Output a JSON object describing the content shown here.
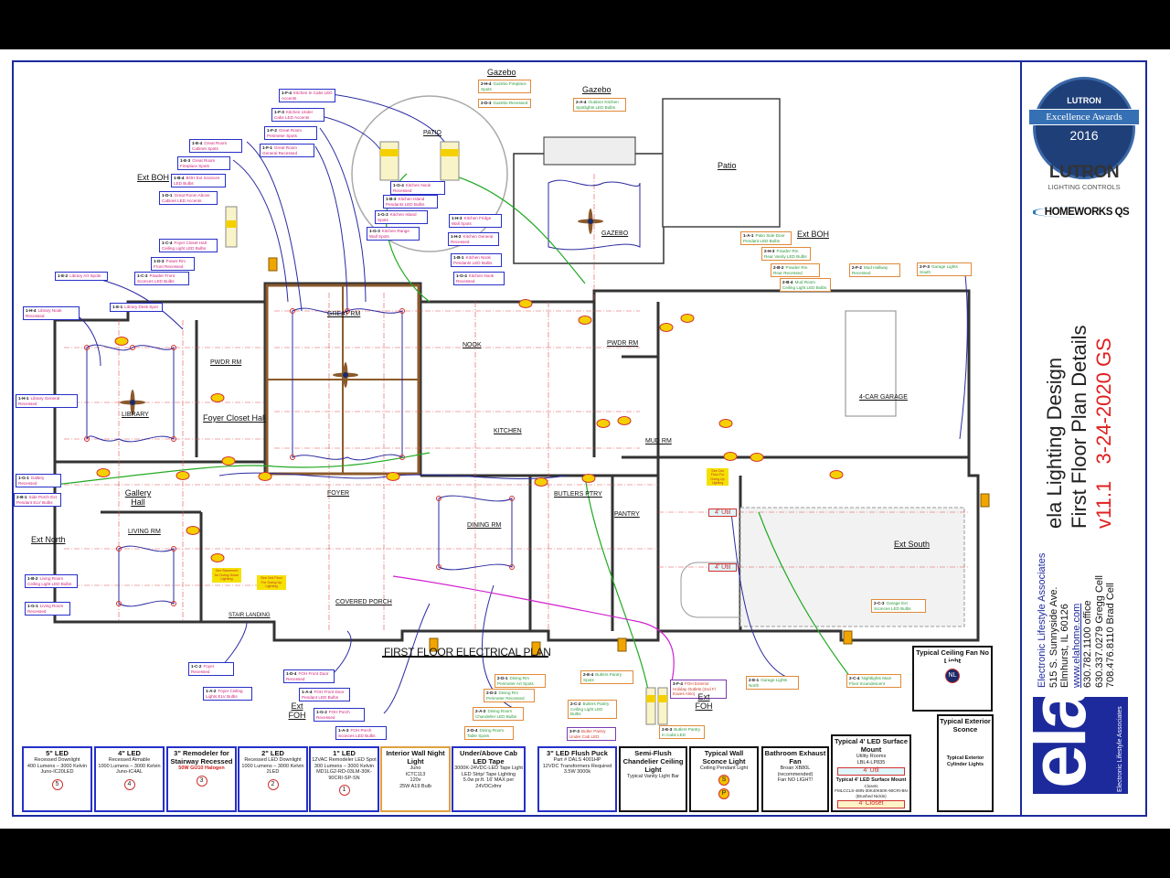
{
  "logos": {
    "award": {
      "brand": "LUTRON",
      "title": "Excellence Awards",
      "year": "2016"
    },
    "lutron": {
      "name": "LUTRON",
      "sub": "LIGHTING CONTROLS"
    },
    "homeworks": "HOMEWORKS QS",
    "ela": {
      "mark": "ela",
      "sub": "Electronic Lifestyle Associates"
    }
  },
  "title_block": {
    "line1": "ela Lighting Design",
    "line2": "First Floor Plan Details",
    "version": "v11.1",
    "date": "3-24-2020 GS"
  },
  "company": {
    "name": "Electronic Lifestyle Associates",
    "address": "515 S. Sunnyside Ave.",
    "city": "Elmhurst, IL 60126",
    "web": "www.elahome.com",
    "office": "630.782.1100 office",
    "cell1": "630.337.0279 Gregg Cell",
    "cell2": "708.476.8110 Brad Cell"
  },
  "plan_title": "FIRST FLOOR ELECTRICAL PLAN",
  "rooms": [
    "Gazebo",
    "Gazebo",
    "PATIO",
    "Patio",
    "GAZEBO",
    "Ext BOH",
    "Ext BOH",
    "GREAT RM",
    "NOOK",
    "KITCHEN",
    "PWDR RM",
    "MUD RM",
    "4-CAR GARAGE",
    "LIBRARY",
    "PWDR RM",
    "Foyer Closet Hall",
    "Gallery Hall",
    "FOYER",
    "BUTLERS PTRY",
    "PANTRY",
    "DINING RM",
    "LIVING RM",
    "Ext North",
    "Ext South",
    "COVERED PORCH",
    "STAIR LANDING",
    "Ext FOH",
    "Ext FOH"
  ],
  "callouts": [
    {
      "code": "1-F-4",
      "text": "Kitchen In Cabs LED Accents",
      "style": "blue"
    },
    {
      "code": "1-F-3",
      "text": "Kitchen Under Cabs LED Accents",
      "style": "blue"
    },
    {
      "code": "1-F-2",
      "text": "Great Room Perimeter Spots",
      "style": "blue"
    },
    {
      "code": "1-F-1",
      "text": "Great Room General Recessed",
      "style": "blue"
    },
    {
      "code": "1-E-4",
      "text": "Great Room Cabinet Spots",
      "style": "blue"
    },
    {
      "code": "1-E-3",
      "text": "Great Room Fireplace Spots",
      "style": "blue"
    },
    {
      "code": "1-B-4",
      "text": "BOH Ext Sconces LED Bulbs",
      "style": "blue"
    },
    {
      "code": "1-D-1",
      "text": "Great Room Above Cabinet LED Accents",
      "style": "blue"
    },
    {
      "code": "1-C-4",
      "text": "Foyer Closet Hall Ceiling Light LED Bulbs",
      "style": "blue"
    },
    {
      "code": "1-D-3",
      "text": "Power Rm Front Recessed",
      "style": "blue"
    },
    {
      "code": "1-C-3",
      "text": "Powder Front Sconces LED Bulbs",
      "style": "blue"
    },
    {
      "code": "1-E-2",
      "text": "Library Art Spots",
      "style": "blue"
    },
    {
      "code": "1-E-1",
      "text": "Library Desk Spot",
      "style": "blue"
    },
    {
      "code": "1-H-4",
      "text": "Library Nook Recessed",
      "style": "blue"
    },
    {
      "code": "1-H-1",
      "text": "Library General Recessed",
      "style": "blue"
    },
    {
      "code": "1-G-1",
      "text": "Gallery Recessed",
      "style": "blue"
    },
    {
      "code": "2-B-1",
      "text": "Side Porch Ext Pendant ELV Bulbs",
      "style": "blue"
    },
    {
      "code": "1-B-2",
      "text": "Living Room Ceiling Light LED Bulbs",
      "style": "blue"
    },
    {
      "code": "1-G-1",
      "text": "Living Room Recessed",
      "style": "blue"
    },
    {
      "code": "1-G-4",
      "text": "Kitchen Nook Recessed",
      "style": "blue"
    },
    {
      "code": "1-B-3",
      "text": "Kitchen Island Pendants LED Bulbs",
      "style": "blue"
    },
    {
      "code": "1-G-2",
      "text": "Kitchen Island Spots",
      "style": "blue"
    },
    {
      "code": "1-G-3",
      "text": "Kitchen Range Wall Spots",
      "style": "blue"
    },
    {
      "code": "1-H-3",
      "text": "Kitchen Fridge Wall Spots",
      "style": "blue"
    },
    {
      "code": "1-H-2",
      "text": "Kitchen General Recessed",
      "style": "blue"
    },
    {
      "code": "1-B-1",
      "text": "Kitchen Nook Pendants LED Bulbs",
      "style": "blue"
    },
    {
      "code": "1-G-4",
      "text": "Kitchen Nook Recessed",
      "style": "blue"
    },
    {
      "code": "2-H-4",
      "text": "Gazebo Fireplace Spots",
      "style": "orange"
    },
    {
      "code": "2-D-3",
      "text": "Gazebo Recessed",
      "style": "orange"
    },
    {
      "code": "2-A-4",
      "text": "Outdoor Kitchen Spotlights LED Bulbs",
      "style": "orange"
    },
    {
      "code": "1-A-1",
      "text": "Patio Side Door Pendant LED Bulbs",
      "style": "orange"
    },
    {
      "code": "2-H-3",
      "text": "Powder Rm Rear Vanity LED Bulbs",
      "style": "orange"
    },
    {
      "code": "2-B-2",
      "text": "Powder Rm Rear Recessed",
      "style": "orange"
    },
    {
      "code": "2-B-4",
      "text": "Mud Room Ceiling Light LED Bulbs",
      "style": "orange"
    },
    {
      "code": "2-F-2",
      "text": "Mud Hallway Recessed",
      "style": "orange"
    },
    {
      "code": "2-F-3",
      "text": "Garage Lights South",
      "style": "orange"
    },
    {
      "code": "2-C-3",
      "text": "Garage Ext Sconces LED Bulbs",
      "style": "orange"
    },
    {
      "code": "2-C-4",
      "text": "Nightlights Main Floor Incandescent",
      "style": "orange"
    },
    {
      "code": "2-E-1",
      "text": "Garage Lights North",
      "style": "orange"
    },
    {
      "code": "3-F-4",
      "text": "FOH Exterior Holiday Outlets (2nd Fl Eaves Also)",
      "style": "purple"
    },
    {
      "code": "2-E-3",
      "text": "Butlers Pantry In Cabs LED",
      "style": "orange"
    },
    {
      "code": "3-F-3",
      "text": "Butler Pantry Under Cab LED",
      "style": "purple"
    },
    {
      "code": "2-E-4",
      "text": "Butlers Pantry Spots",
      "style": "orange"
    },
    {
      "code": "2-C-2",
      "text": "Butlers Pantry Ceiling Light LED Bulbs",
      "style": "orange"
    },
    {
      "code": "2-D-1",
      "text": "Dining Rm Perimeter Art Spots",
      "style": "orange"
    },
    {
      "code": "2-D-2",
      "text": "Dining Rm Perimeter Recessed",
      "style": "orange"
    },
    {
      "code": "2-A-2",
      "text": "Dining Room Chandelier LED Bulbs",
      "style": "orange"
    },
    {
      "code": "2-D-4",
      "text": "Dining Room Table Spots",
      "style": "orange"
    },
    {
      "code": "1-C-2",
      "text": "Foyer Recessed",
      "style": "blue"
    },
    {
      "code": "1-D-4",
      "text": "FOH Front Door Recessed",
      "style": "blue"
    },
    {
      "code": "1-A-2",
      "text": "Foyer Ceiling Lights ELV Bulbs",
      "style": "blue"
    },
    {
      "code": "1-A-4",
      "text": "FOH Front Door Pendant LED Bulbs",
      "style": "blue"
    },
    {
      "code": "1-G-2",
      "text": "FOH Porch Recessed",
      "style": "blue"
    },
    {
      "code": "1-A-3",
      "text": "FOH Porch Sconces LED Bulbs",
      "style": "blue"
    }
  ],
  "legend": [
    {
      "title": "5\" LED",
      "lines": [
        "Recessed Downlight",
        "400 Lumens – 3000 Kelvin",
        "Juno-IC20LED"
      ],
      "mark": "5"
    },
    {
      "title": "4\" LED",
      "lines": [
        "Recessed Aimable",
        "1000 Lumens – 3000 Kelvin",
        "Juno-IC4AL"
      ],
      "mark": "4"
    },
    {
      "title": "3\" Remodeler for Stairway Recessed",
      "lines": [
        "50W GU10 Halogen"
      ],
      "mark": "3"
    },
    {
      "title": "2\" LED",
      "lines": [
        "Recessed LED Downlight",
        "1000 Lumens – 3000 Kelvin",
        "2LED"
      ],
      "mark": "2"
    },
    {
      "title": "1\" LED",
      "lines": [
        "12VAC Remodeler LED Spot",
        "300 Lumens – 3000 Kelvin",
        "MD1LG2-RD-03LM-30K-90CRI-SP-SN"
      ],
      "mark": "1"
    },
    {
      "title": "Interior Wall Night Light",
      "lines": [
        "Juno",
        "ICTC113",
        "120v",
        "25W A19 Bulb"
      ]
    },
    {
      "title": "Under/Above Cab LED Tape",
      "lines": [
        "3000K-24VDC-LED Tape Light",
        "LED Strip/ Tape Lighting",
        "5.0w pr.ft. 16' MAX per 24VDCxfmr"
      ]
    },
    {
      "title": "3\" LED Flush Puck",
      "lines": [
        "Part # DALS 4001HP",
        "12VDC Transformers Required",
        "3.5W 3000k"
      ]
    },
    {
      "title": "Semi-Flush Chandelier Ceiling Light",
      "lines": [
        "Typical Vanity Light Bar"
      ]
    },
    {
      "title": "Typical Wall Sconce Light",
      "lines": [
        "Ceiling Pendant Light"
      ],
      "marks": [
        "S",
        "P"
      ]
    },
    {
      "title": "Bathroom Exhaust Fan",
      "lines": [
        "Broan XB80L (recommended)",
        "Fan NO LIGHT!"
      ]
    },
    {
      "title": "Typical 4' LED Surface Mount",
      "lines": [
        "Utility Rooms",
        "LBL4-LP835"
      ],
      "tag": "4' Util",
      "title2": "Typical 4' LED Surface Mount",
      "lines2": [
        "Closets",
        "FMLCCLS-48IN-30K40K50K-90CRI-BN (Brushed Nickle)"
      ],
      "tag2": "4' Closet"
    },
    {
      "title": "Typical Ceiling Fan No Light",
      "mark": "NL"
    },
    {
      "title": "Typical Exterior Sconce",
      "title2": "Typical Exterior Cylinder Lights"
    }
  ],
  "plan_tags": {
    "util": "4' Util",
    "see_basement": "See Basement for Going Down Lighting",
    "see_2nd": "See 2nd Floor For Going Up Lighting"
  },
  "colors": {
    "frame": "#1c2a9c",
    "callout_blue": "#2630c8",
    "callout_orange": "#e08a3a",
    "callout_purple": "#7b3bb0",
    "wire": "#2a2aa0",
    "green_wire": "#22aa22",
    "version_red": "#e02020"
  }
}
